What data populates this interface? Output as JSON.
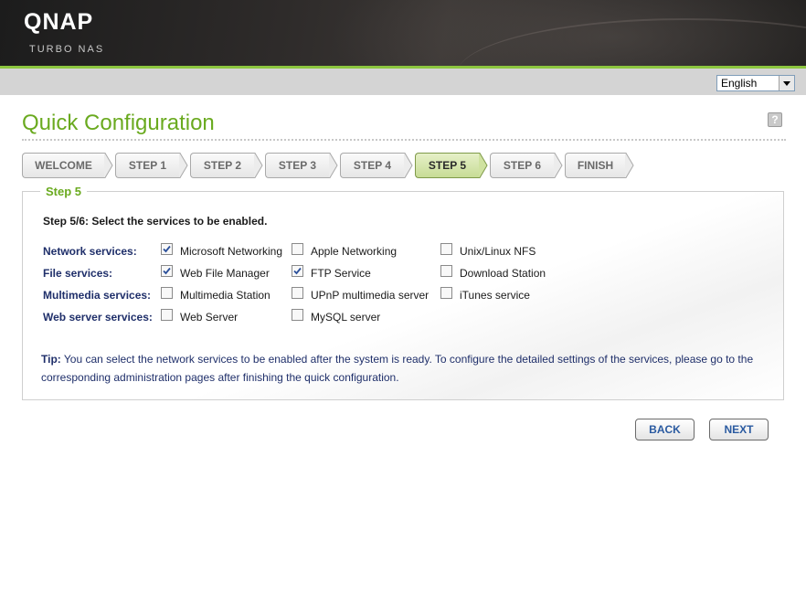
{
  "header": {
    "brand": "QNAP",
    "product": "TURBO NAS"
  },
  "language": {
    "selected": "English"
  },
  "page": {
    "title": "Quick Configuration",
    "help": "?"
  },
  "steps": [
    {
      "label": "WELCOME",
      "active": false
    },
    {
      "label": "STEP 1",
      "active": false
    },
    {
      "label": "STEP 2",
      "active": false
    },
    {
      "label": "STEP 3",
      "active": false
    },
    {
      "label": "STEP 4",
      "active": false
    },
    {
      "label": "STEP 5",
      "active": true
    },
    {
      "label": "STEP 6",
      "active": false
    },
    {
      "label": "FINISH",
      "active": false
    }
  ],
  "panel": {
    "legend": "Step 5",
    "instruction": "Step 5/6: Select the services to be enabled.",
    "rows": [
      {
        "label": "Network services:",
        "options": [
          {
            "label": "Microsoft Networking",
            "checked": true
          },
          {
            "label": "Apple Networking",
            "checked": false
          },
          {
            "label": "Unix/Linux NFS",
            "checked": false
          }
        ]
      },
      {
        "label": "File services:",
        "options": [
          {
            "label": "Web File Manager",
            "checked": true
          },
          {
            "label": "FTP Service",
            "checked": true
          },
          {
            "label": "Download Station",
            "checked": false
          }
        ]
      },
      {
        "label": "Multimedia services:",
        "options": [
          {
            "label": "Multimedia Station",
            "checked": false
          },
          {
            "label": "UPnP multimedia server",
            "checked": false
          },
          {
            "label": "iTunes service",
            "checked": false
          }
        ]
      },
      {
        "label": "Web server services:",
        "options": [
          {
            "label": "Web Server",
            "checked": false
          },
          {
            "label": "MySQL server",
            "checked": false
          }
        ]
      }
    ],
    "tip_label": "Tip:",
    "tip_text": " You can select the network services to be enabled after the system is ready. To configure the detailed settings of the services, please go to the corresponding administration pages after finishing the quick configuration."
  },
  "buttons": {
    "back": "BACK",
    "next": "NEXT"
  },
  "colors": {
    "accent": "#6aaa1f",
    "label_blue": "#1f2f6a",
    "active_step": "#c7dc95"
  }
}
